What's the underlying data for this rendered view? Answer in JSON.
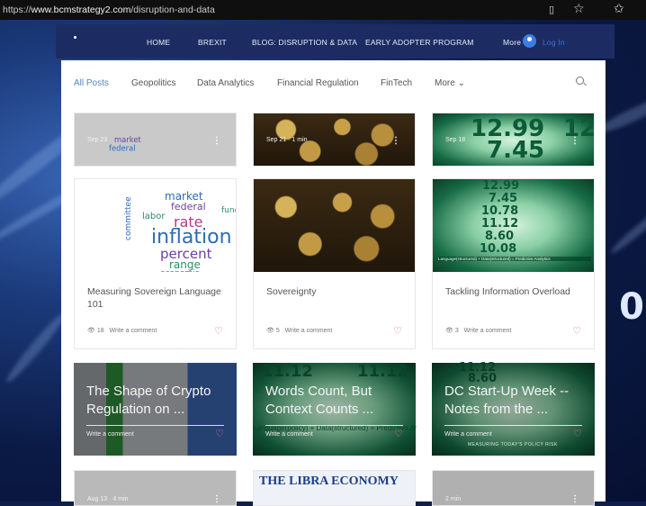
{
  "browser": {
    "url_prefix": "https://",
    "url_host": "www.bcmstrategy2.com",
    "url_path": "/disruption-and-data"
  },
  "nav": {
    "items": [
      "HOME",
      "BREXIT",
      "BLOG: DISRUPTION & DATA",
      "EARLY ADOPTER PROGRAM"
    ],
    "more": "More",
    "login": "Log In"
  },
  "categories": {
    "items": [
      "All Posts",
      "Geopolitics",
      "Data Analytics",
      "Financial Regulation",
      "FinTech"
    ],
    "more": "More"
  },
  "row1": [
    {
      "date": "Sep 23"
    },
    {
      "date": "Sep 21",
      "read": "1 min"
    },
    {
      "date": "Sep 18"
    }
  ],
  "cards": [
    {
      "title": "Measuring Sovereign Language 101",
      "views": "18",
      "comment": "Write a comment"
    },
    {
      "title": "Sovereignty",
      "views": "5",
      "comment": "Write a comment"
    },
    {
      "title": "Tackling Information Overload",
      "views": "3",
      "comment": "Write a comment"
    }
  ],
  "overlay_cards": [
    {
      "title": "The Shape of Crypto Regulation on ...",
      "comment": "Write a comment"
    },
    {
      "title": "Words Count, But Context Counts ...",
      "comment": "Write a comment"
    },
    {
      "title": "DC Start-Up Week -- Notes from the ...",
      "comment": "Write a comment"
    }
  ],
  "row4": {
    "libra": "THE LIBRA ECONOMY",
    "left_date": "Aug 13",
    "left_read": "4 min",
    "right_read": "2 min"
  },
  "word_cloud": [
    "market",
    "federal",
    "inflation",
    "rate",
    "percent",
    "range",
    "economic",
    "committee",
    "funds",
    "labor"
  ],
  "numbers": [
    "12.99",
    "7.45",
    "10.78",
    "11.12",
    "8.60",
    "10.08"
  ],
  "green_caption": "Language(structured) + Data(structured) = Predictive Analytics",
  "green_mid_caption": "Language(policy) + Data(structured) = Predictive Ar",
  "dc_caption": "MEASURING TODAY'S POLICY RISK",
  "colors": {
    "nav_bg": "#1c2c63",
    "accent": "#4e86c9",
    "heart": "#e26a6a"
  }
}
